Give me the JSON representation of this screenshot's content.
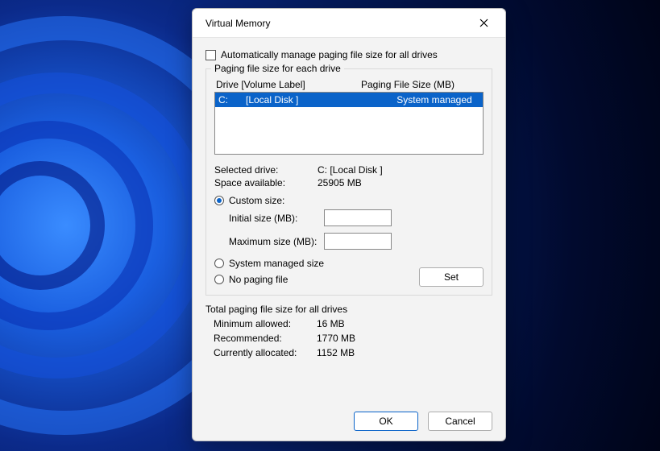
{
  "dialog": {
    "title": "Virtual Memory",
    "auto_manage_label": "Automatically manage paging file size for all drives",
    "auto_manage_checked": false,
    "group1_legend": "Paging file size for each drive",
    "head_drive": "Drive  [Volume Label]",
    "head_size": "Paging File Size (MB)",
    "drives": [
      {
        "letter": "C:",
        "label": "[Local Disk ]",
        "paging": "System managed",
        "selected": true
      }
    ],
    "selected_drive_label": "Selected drive:",
    "selected_drive_value": "C:  [Local Disk ]",
    "space_avail_label": "Space available:",
    "space_avail_value": "25905 MB",
    "radio_custom": "Custom size:",
    "initial_label": "Initial size (MB):",
    "initial_value": "",
    "max_label": "Maximum size (MB):",
    "max_value": "",
    "radio_system": "System managed size",
    "radio_none": "No paging file",
    "radio_selected": "custom",
    "set_button": "Set",
    "totals_legend": "Total paging file size for all drives",
    "min_label": "Minimum allowed:",
    "min_value": "16 MB",
    "rec_label": "Recommended:",
    "rec_value": "1770 MB",
    "cur_label": "Currently allocated:",
    "cur_value": "1152 MB",
    "ok": "OK",
    "cancel": "Cancel"
  }
}
